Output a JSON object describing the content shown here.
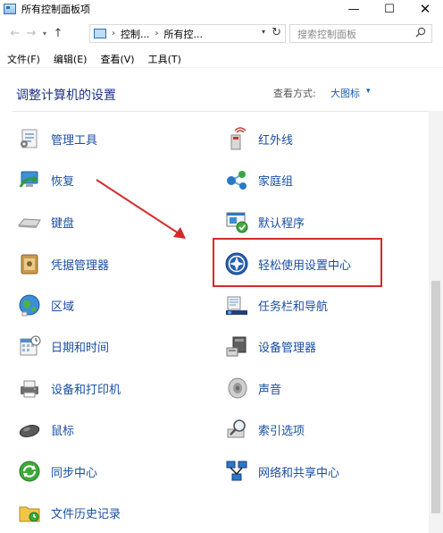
{
  "window": {
    "title": "所有控制面板项",
    "minimize_glyph": "—",
    "maximize_glyph": "☐",
    "close_glyph": "✕"
  },
  "navigation": {
    "back_glyph": "←",
    "forward_glyph": "→",
    "recent_glyph": "▾",
    "up_glyph": "↑",
    "breadcrumbs": [
      "控制...",
      "所有控..."
    ],
    "separator_glyph": "›",
    "refresh_glyph": "↻",
    "search_placeholder": "搜索控制面板"
  },
  "menu": {
    "items": [
      "文件(F)",
      "编辑(E)",
      "查看(V)",
      "工具(T)"
    ]
  },
  "content": {
    "title": "调整计算机的设置",
    "view_by_label": "查看方式:",
    "view_by_value": "大图标",
    "view_by_caret": "▾"
  },
  "items_left": [
    {
      "label": "管理工具",
      "icon": "admin-tools-icon"
    },
    {
      "label": "恢复",
      "icon": "recovery-icon"
    },
    {
      "label": "键盘",
      "icon": "keyboard-icon"
    },
    {
      "label": "凭据管理器",
      "icon": "credential-manager-icon"
    },
    {
      "label": "区域",
      "icon": "region-icon"
    },
    {
      "label": "日期和时间",
      "icon": "date-time-icon"
    },
    {
      "label": "设备和打印机",
      "icon": "devices-printers-icon"
    },
    {
      "label": "鼠标",
      "icon": "mouse-icon"
    },
    {
      "label": "同步中心",
      "icon": "sync-center-icon"
    },
    {
      "label": "文件历史记录",
      "icon": "file-history-icon"
    }
  ],
  "items_right": [
    {
      "label": "红外线",
      "icon": "infrared-icon"
    },
    {
      "label": "家庭组",
      "icon": "homegroup-icon"
    },
    {
      "label": "默认程序",
      "icon": "default-programs-icon"
    },
    {
      "label": "轻松使用设置中心",
      "icon": "ease-of-access-icon"
    },
    {
      "label": "任务栏和导航",
      "icon": "taskbar-navigation-icon"
    },
    {
      "label": "设备管理器",
      "icon": "device-manager-icon"
    },
    {
      "label": "声音",
      "icon": "sound-icon"
    },
    {
      "label": "索引选项",
      "icon": "indexing-options-icon"
    },
    {
      "label": "网络和共享中心",
      "icon": "network-sharing-icon"
    }
  ],
  "colors": {
    "link": "#1a4fa3",
    "heading": "#1e3287",
    "highlight": "#d52a2a"
  }
}
